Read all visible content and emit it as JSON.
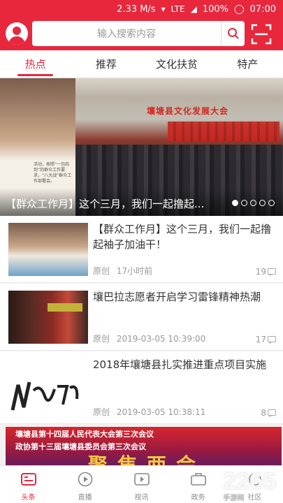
{
  "status": {
    "speed": "2.33 M/s",
    "battery": "100%",
    "time": "07:00",
    "network": "LTE"
  },
  "search": {
    "placeholder": "输入搜索内容"
  },
  "tabs": [
    {
      "label": "热点",
      "active": true
    },
    {
      "label": "推荐"
    },
    {
      "label": "文化扶贫"
    },
    {
      "label": "特产"
    }
  ],
  "banner": {
    "caption": "【群众工作月】这个三月，我们一起撸起...",
    "stage_title": "壤塘县文化发展大会",
    "side_text": "活动，按照“一包四到”的群众工作要求，“八大战”群众工作部署会。"
  },
  "articles": [
    {
      "title": "【群众工作月】这个三月，我们一起撸起袖子加油干！",
      "source": "原创",
      "time": "17小时前",
      "comments": "19"
    },
    {
      "title": "壤巴拉志愿者开启学习雷锋精神热潮",
      "source": "原创",
      "time": "2019-03-05 10:39:00",
      "comments": "17"
    },
    {
      "title": "2018年壤塘县扎实推进重点项目实施",
      "source": "原创",
      "time": "2019-03-05 10:38:11",
      "comments": "8"
    }
  ],
  "ad": {
    "line1": "壤塘县第十四届人民代表大会第三次会议",
    "line2": "政协第十三届壤塘县委员会第三次会议",
    "big": "聚焦两会"
  },
  "bottom_nav": [
    {
      "label": "头条",
      "icon": "news-icon",
      "active": true
    },
    {
      "label": "直播",
      "icon": "play-icon"
    },
    {
      "label": "视讯",
      "icon": "video-icon"
    },
    {
      "label": "政务",
      "icon": "briefcase-icon"
    },
    {
      "label": "社区",
      "icon": "community-icon"
    }
  ],
  "watermark": {
    "text": "2265",
    "sub": "手游网"
  },
  "colors": {
    "accent": "#e8273d"
  }
}
